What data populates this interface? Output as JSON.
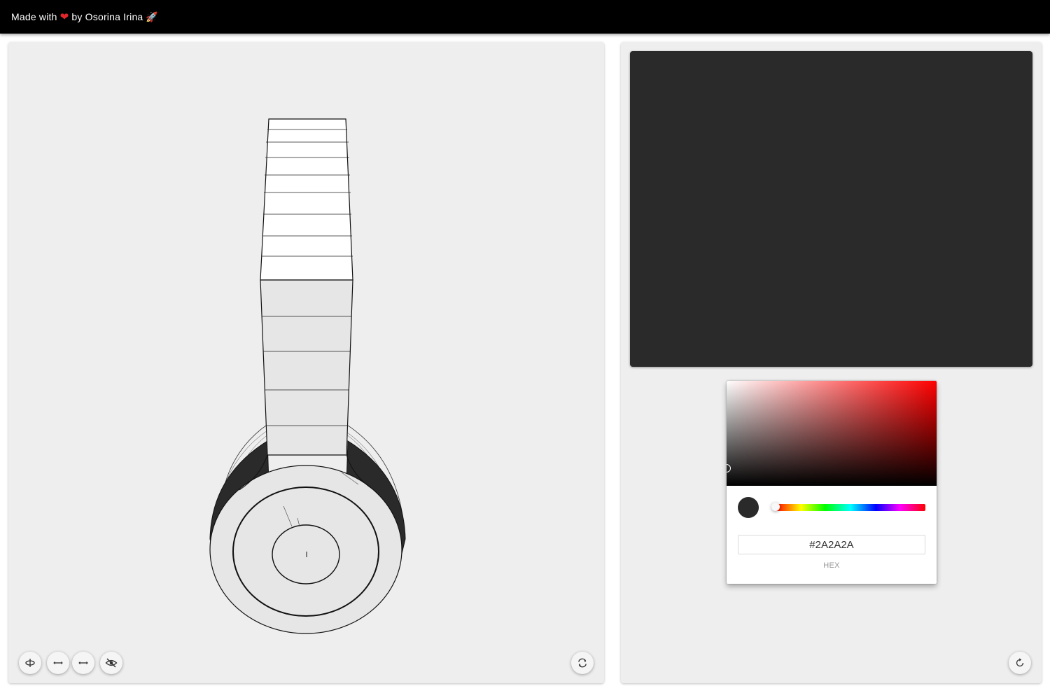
{
  "header": {
    "prefix": "Made with",
    "heart": "❤",
    "suffix": "by Osorina Irina",
    "rocket": "🚀"
  },
  "viewer": {
    "tools": [
      {
        "name": "rotate-axis-icon"
      },
      {
        "name": "horizontal-arrows-icon"
      },
      {
        "name": "horizontal-arrows-icon"
      },
      {
        "name": "eye-off-icon"
      }
    ],
    "reset_icon": "sync-icon"
  },
  "preview": {
    "color": "#2A2A2A"
  },
  "picker": {
    "hue_color": "#ff0000",
    "current_color": "#2A2A2A",
    "hex_value": "#2A2A2A",
    "hex_label": "hex",
    "saturation": 0,
    "value": 0.165,
    "hue": 0
  },
  "right_panel": {
    "reset_icon": "refresh-icon"
  }
}
